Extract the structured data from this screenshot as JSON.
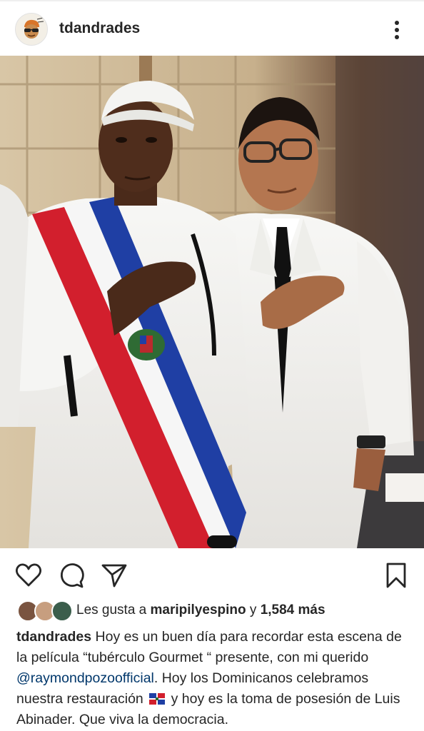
{
  "post": {
    "username": "tdandrades",
    "avatar_icon": "cartoon-avatar-icon",
    "more_icon": "more-vertical-icon",
    "photo_alt": "two-men-white-suits-photo"
  },
  "actions": {
    "like_icon": "heart-icon",
    "comment_icon": "comment-icon",
    "share_icon": "send-icon",
    "save_icon": "bookmark-icon"
  },
  "likes": {
    "prefix": "Les gusta a",
    "user": "maripilyespino",
    "conj": "y",
    "count": "1,584 más"
  },
  "caption": {
    "username": "tdandrades",
    "text1": "Hoy es un buen día para recordar esta escena de la película “tubérculo Gourmet “ presente, con mi querido",
    "mention": "@raymondpozoofficial",
    "text2": ". Hoy los Dominicanos celebramos nuestra restauración",
    "flag_icon": "dominican-flag-icon",
    "text3": "y hoy es la toma de posesión de Luis Abinader. Que viva la democracia."
  },
  "colors": {
    "text": "#262626",
    "mention": "#00376b",
    "flag_blue": "#1f3fa4",
    "flag_red": "#d21f2d"
  }
}
